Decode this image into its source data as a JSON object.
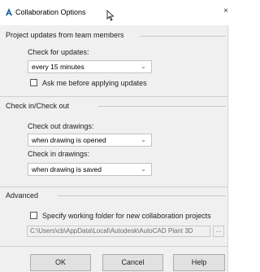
{
  "window": {
    "title": "Collaboration Options",
    "icon": "autocad-a-icon",
    "close_glyph": "×"
  },
  "project_updates": {
    "group_label": "Project updates from team members",
    "check_label": "Check for updates:",
    "check_value": "every 15 minutes",
    "ask_label": "Ask me before applying updates",
    "ask_checked": false
  },
  "checkin_checkout": {
    "group_label": "Check in/Check out",
    "checkout_label": "Check out drawings:",
    "checkout_value": "when drawing is opened",
    "checkin_label": "Check in drawings:",
    "checkin_value": "when drawing is saved"
  },
  "advanced": {
    "group_label": "Advanced",
    "folder_label": "Specify working folder for new collaboration projects",
    "folder_checked": false,
    "folder_path": "C:\\Users\\cb\\AppData\\Local\\Autodesk\\AutoCAD Plant 3D",
    "browse_label": "..."
  },
  "buttons": {
    "ok": "OK",
    "cancel": "Cancel",
    "help": "Help"
  }
}
